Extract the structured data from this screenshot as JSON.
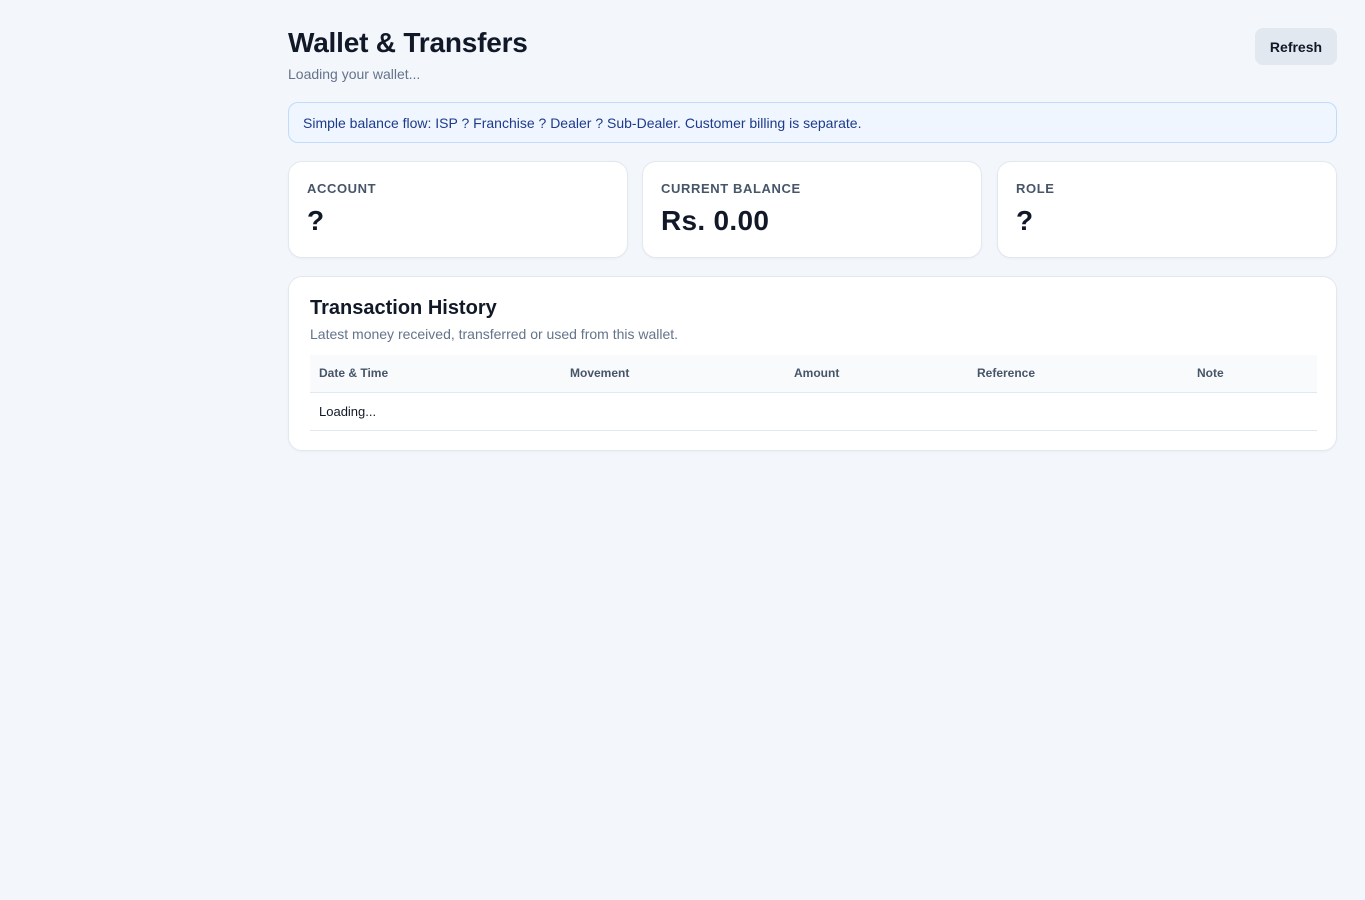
{
  "header": {
    "title": "Wallet & Transfers",
    "subtitle": "Loading your wallet...",
    "refresh_label": "Refresh"
  },
  "banner": {
    "text": "Simple balance flow: ISP ? Franchise ? Dealer ? Sub-Dealer. Customer billing is separate."
  },
  "stats": [
    {
      "label": "ACCOUNT",
      "value": "?"
    },
    {
      "label": "CURRENT BALANCE",
      "value": "Rs. 0.00"
    },
    {
      "label": "ROLE",
      "value": "?"
    }
  ],
  "history": {
    "title": "Transaction History",
    "subtitle": "Latest money received, transferred or used from this wallet.",
    "columns": [
      "Date & Time",
      "Movement",
      "Amount",
      "Reference",
      "Note"
    ],
    "status_text": "Loading..."
  },
  "colors": {
    "page_background": "#f3f6fb",
    "banner_background": "#eff6ff",
    "banner_border": "#bfdbfe",
    "banner_text": "#1e3a8a",
    "button_background": "#e2e8f0"
  }
}
